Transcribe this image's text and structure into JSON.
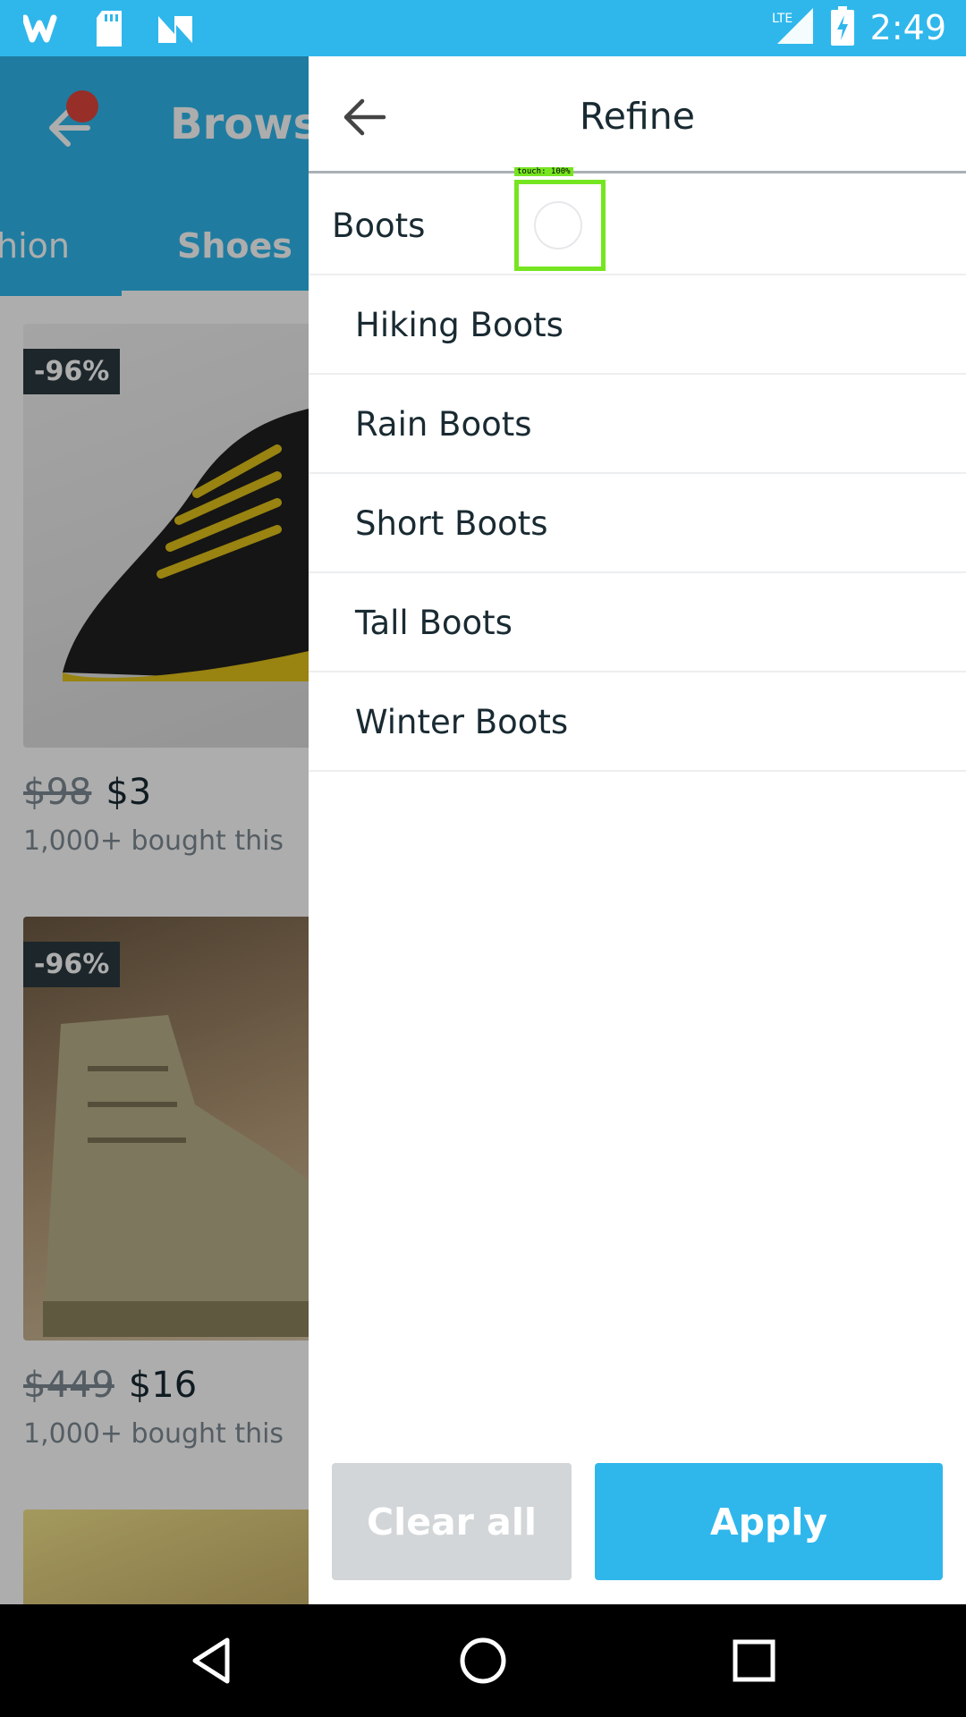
{
  "status_bar": {
    "time": "2:49",
    "network": "LTE",
    "left_icons": [
      "wish-app-icon",
      "sd-card-icon",
      "n-app-icon"
    ]
  },
  "background": {
    "title": "Browse",
    "tabs": [
      "hion",
      "Shoes"
    ],
    "products": [
      {
        "discount": "-96%",
        "price_old": "$98",
        "price_new": "$3",
        "bought": "1,000+ bought this"
      },
      {
        "discount": "-96%",
        "price_old": "$449",
        "price_new": "$16",
        "bought": "1,000+ bought this"
      }
    ]
  },
  "refine": {
    "title": "Refine",
    "parent_category": "Boots",
    "touch_label": "touch: 100%",
    "options": [
      "Hiking Boots",
      "Rain Boots",
      "Short Boots",
      "Tall Boots",
      "Winter Boots"
    ],
    "clear_label": "Clear all",
    "apply_label": "Apply"
  },
  "colors": {
    "accent": "#2fb7ec",
    "text": "#192a32",
    "muted": "#7c8a92",
    "touch_highlight": "#76e521"
  }
}
